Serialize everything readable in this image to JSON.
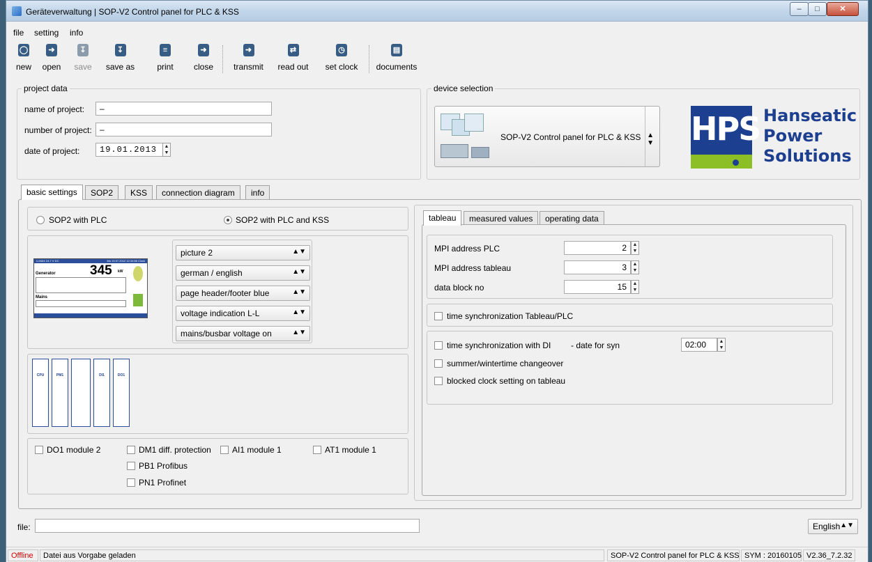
{
  "window": {
    "title": "Geräteverwaltung | SOP-V2 Control panel for PLC & KSS"
  },
  "menu": [
    "file",
    "setting",
    "info"
  ],
  "toolbar": [
    {
      "label": "new",
      "icon": "new-icon",
      "enabled": true
    },
    {
      "label": "open",
      "icon": "open-icon",
      "enabled": true
    },
    {
      "label": "save",
      "icon": "save-icon",
      "enabled": false
    },
    {
      "label": "save as",
      "icon": "save-as-icon",
      "enabled": true
    },
    {
      "label": "print",
      "icon": "print-icon",
      "enabled": true
    },
    {
      "label": "close",
      "icon": "close-file-icon",
      "enabled": true
    },
    {
      "label": "transmit",
      "icon": "transmit-icon",
      "enabled": true
    },
    {
      "label": "read out",
      "icon": "read-out-icon",
      "enabled": true
    },
    {
      "label": "set clock",
      "icon": "set-clock-icon",
      "enabled": true
    },
    {
      "label": "documents",
      "icon": "documents-icon",
      "enabled": true
    }
  ],
  "project": {
    "title": "project data",
    "name_label": "name of project:",
    "name_value": "–",
    "number_label": "number of project:",
    "number_value": "–",
    "date_label": "date of project:",
    "date_value": "19.01.2013"
  },
  "device": {
    "title": "device selection",
    "selected": "SOP-V2 Control panel for PLC & KSS"
  },
  "logo": {
    "abbr": "HPS",
    "line1": "Hanseatic",
    "line2": "Power",
    "line3": "Solutions",
    "blue": "#1d3f8f",
    "green": "#8cbf26"
  },
  "main_tabs": [
    "basic settings",
    "SOP2",
    "KSS",
    "connection diagram",
    "info"
  ],
  "basic": {
    "radio1": "SOP2 with PLC",
    "radio2": "SOP2 with PLC and KSS",
    "preview": {
      "value": "345",
      "unit": "kW",
      "section1": "Generator",
      "section2": "Mains",
      "header_left": "U-MAX 24.7 V DC",
      "header_right": "Mo 19.07.2012 12:34:56 Clock"
    },
    "dropdowns": [
      "picture 2",
      "german / english",
      "page header/footer blue",
      "voltage indication L-L",
      "mains/busbar voltage on"
    ],
    "modules": [
      "CPU",
      "PM1",
      "",
      "DI1",
      "DO1"
    ],
    "checkboxes": [
      "DO1 module 2",
      "DM1 diff. protection",
      "AI1 module 1",
      "AT1 module 1",
      "PB1 Profibus",
      "PN1 Profinet"
    ]
  },
  "right_tabs": [
    "tableau",
    "measured values",
    "operating data"
  ],
  "tableau": {
    "mpi_plc_label": "MPI address PLC",
    "mpi_plc_value": "2",
    "mpi_tableau_label": "MPI address tableau",
    "mpi_tableau_value": "3",
    "db_label": "data block no",
    "db_value": "15",
    "sync_tableau_plc": "time synchronization Tableau/PLC",
    "sync_di": "time synchronization with DI",
    "date_for_syn_label": "- date for syn",
    "date_for_syn_value": "02:00",
    "summer_winter": "summer/wintertime changeover",
    "blocked_clock": "blocked clock setting on tableau"
  },
  "file_label": "file:",
  "language": "English",
  "status": {
    "state": "Offline",
    "message": "Datei aus Vorgabe geladen",
    "device": "SOP-V2 Control panel for PLC & KSS",
    "sym": "SYM : 20160105",
    "version": "V2.36_7.2.32",
    "offline_color": "#d40000"
  }
}
